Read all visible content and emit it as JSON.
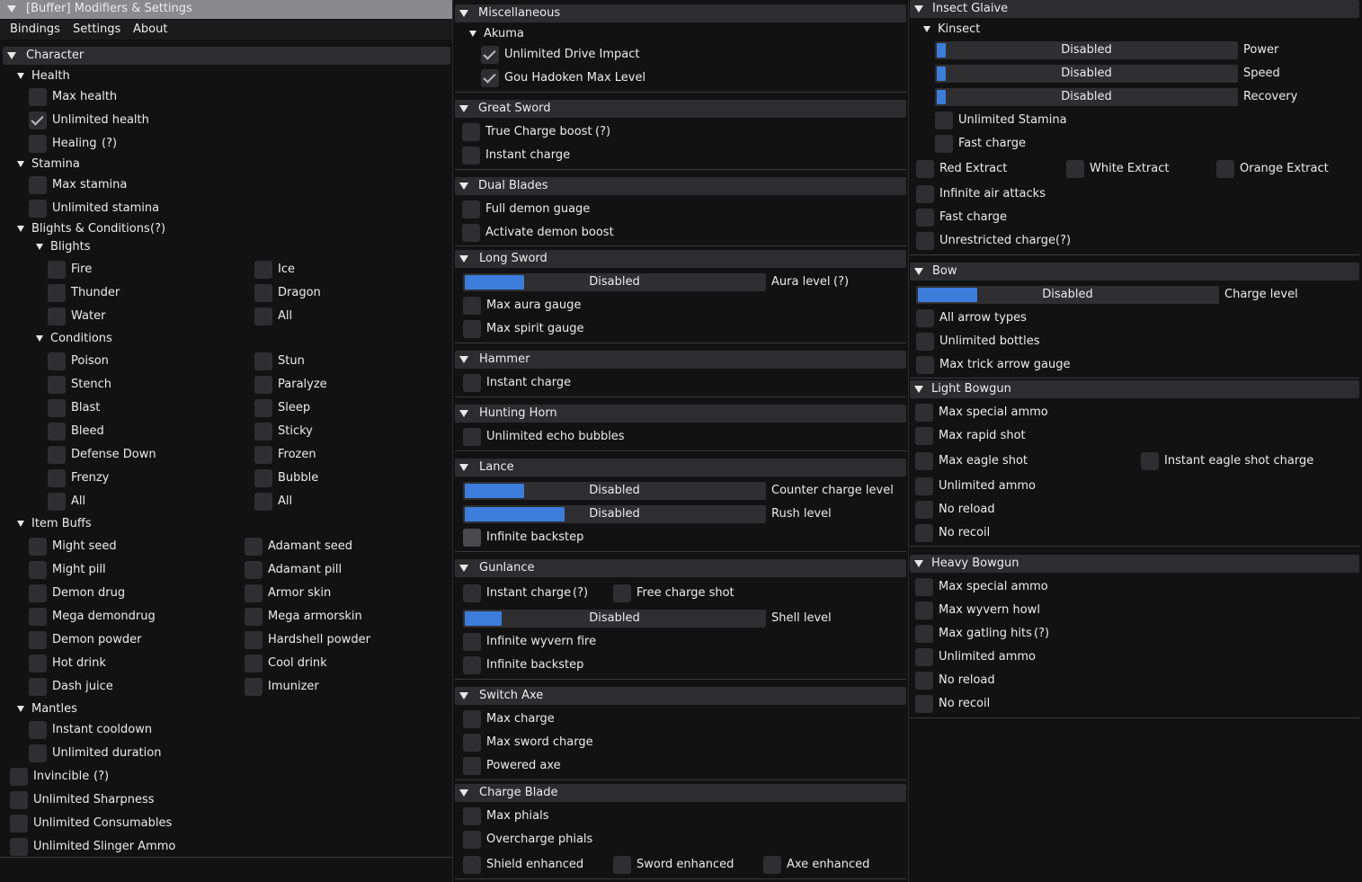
{
  "window": {
    "title": "[Buffer] Modifiers & Settings",
    "menu": [
      "Bindings",
      "Settings",
      "About"
    ]
  },
  "character": {
    "title": "Character",
    "health": {
      "title": "Health",
      "max": "Max health",
      "unlimited": "Unlimited health",
      "healing": "Healing",
      "healing_help": "(?)"
    },
    "stamina": {
      "title": "Stamina",
      "max": "Max stamina",
      "unlimited": "Unlimited stamina"
    },
    "blights_conditions": {
      "title": "Blights & Conditions",
      "help": "(?)",
      "blights": {
        "title": "Blights",
        "left": [
          "Fire",
          "Thunder",
          "Water"
        ],
        "right": [
          "Ice",
          "Dragon",
          "All"
        ]
      },
      "conditions": {
        "title": "Conditions",
        "left": [
          "Poison",
          "Stench",
          "Blast",
          "Bleed",
          "Defense Down",
          "Frenzy",
          "All"
        ],
        "right": [
          "Stun",
          "Paralyze",
          "Sleep",
          "Sticky",
          "Frozen",
          "Bubble",
          "All"
        ]
      }
    },
    "item_buffs": {
      "title": "Item Buffs",
      "left": [
        "Might seed",
        "Might pill",
        "Demon drug",
        "Mega demondrug",
        "Demon powder",
        "Hot drink",
        "Dash juice"
      ],
      "right": [
        "Adamant seed",
        "Adamant pill",
        "Armor skin",
        "Mega armorskin",
        "Hardshell powder",
        "Cool drink",
        "Imunizer"
      ]
    },
    "mantles": {
      "title": "Mantles",
      "items": [
        "Instant cooldown",
        "Unlimited duration"
      ]
    },
    "misc": {
      "invincible": "Invincible",
      "invincible_help": "(?)",
      "items": [
        "Unlimited Sharpness",
        "Unlimited Consumables",
        "Unlimited Slinger Ammo"
      ]
    }
  },
  "middle": {
    "misc": {
      "title": "Miscellaneous",
      "akuma": {
        "title": "Akuma",
        "items": [
          "Unlimited Drive Impact",
          "Gou Hadoken Max Level"
        ]
      }
    },
    "great_sword": {
      "title": "Great Sword",
      "true_charge": "True Charge boost",
      "help": "(?)",
      "instant": "Instant charge"
    },
    "dual_blades": {
      "title": "Dual Blades",
      "items": [
        "Full demon guage",
        "Activate demon boost"
      ]
    },
    "long_sword": {
      "title": "Long Sword",
      "slider": "Disabled",
      "slider_label": "Aura level",
      "help": "(?)",
      "items": [
        "Max aura gauge",
        "Max spirit gauge"
      ]
    },
    "hammer": {
      "title": "Hammer",
      "items": [
        "Instant charge"
      ]
    },
    "hunting_horn": {
      "title": "Hunting Horn",
      "items": [
        "Unlimited echo bubbles"
      ]
    },
    "lance": {
      "title": "Lance",
      "counter": "Disabled",
      "counter_label": "Counter charge level",
      "rush": "Disabled",
      "rush_label": "Rush level",
      "backstep": "Infinite backstep"
    },
    "gunlance": {
      "title": "Gunlance",
      "instant": "Instant charge",
      "help": "(?)",
      "free": "Free charge shot",
      "shell": "Disabled",
      "shell_label": "Shell level",
      "items": [
        "Infinite wyvern fire",
        "Infinite backstep"
      ]
    },
    "switch_axe": {
      "title": "Switch Axe",
      "items": [
        "Max charge",
        "Max sword charge",
        "Powered axe"
      ]
    },
    "charge_blade": {
      "title": "Charge Blade",
      "items": [
        "Max phials",
        "Overcharge phials"
      ],
      "row": [
        "Shield enhanced",
        "Sword enhanced",
        "Axe enhanced"
      ]
    }
  },
  "right": {
    "insect_glaive": {
      "title": "Insect Glaive",
      "kinsect": {
        "title": "Kinsect",
        "sliders": [
          {
            "value": "Disabled",
            "label": "Power"
          },
          {
            "value": "Disabled",
            "label": "Speed"
          },
          {
            "value": "Disabled",
            "label": "Recovery"
          }
        ],
        "items": [
          "Unlimited Stamina",
          "Fast charge"
        ]
      },
      "extracts": [
        "Red Extract",
        "White Extract",
        "Orange Extract"
      ],
      "items": [
        "Infinite air attacks",
        "Fast charge"
      ],
      "unrestricted": "Unrestricted charge",
      "help": "(?)"
    },
    "bow": {
      "title": "Bow",
      "slider": "Disabled",
      "slider_label": "Charge level",
      "items": [
        "All arrow types",
        "Unlimited bottles",
        "Max trick arrow gauge"
      ]
    },
    "light_bowgun": {
      "title": "Light Bowgun",
      "items": [
        "Max special ammo",
        "Max rapid shot"
      ],
      "eagle": "Max eagle shot",
      "eagle_instant": "Instant eagle shot charge",
      "items2": [
        "Unlimited ammo",
        "No reload",
        "No recoil"
      ]
    },
    "heavy_bowgun": {
      "title": "Heavy Bowgun",
      "items": [
        "Max special ammo",
        "Max wyvern howl"
      ],
      "gatling": "Max gatling hits",
      "help": "(?)",
      "items2": [
        "Unlimited ammo",
        "No reload",
        "No recoil"
      ]
    }
  },
  "colors": {
    "accent": "#3c7ddc",
    "header": "#2d2d2f",
    "background": "#121212"
  }
}
